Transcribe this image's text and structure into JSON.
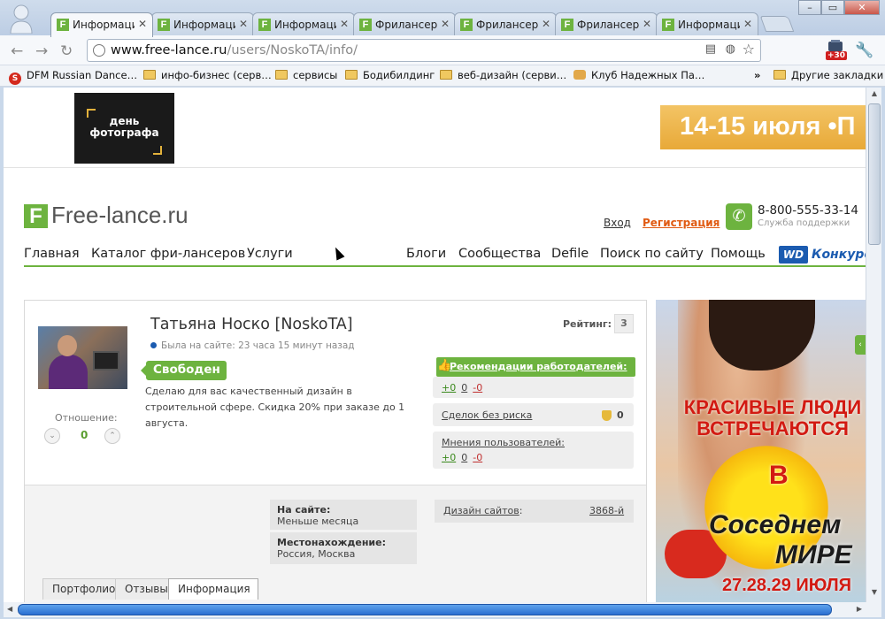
{
  "browser": {
    "tabs": [
      {
        "label": "Информаци",
        "close": "✕"
      },
      {
        "label": "Информаци",
        "close": "✕"
      },
      {
        "label": "Информаци",
        "close": "✕"
      },
      {
        "label": "Фрилансер",
        "close": "✕"
      },
      {
        "label": "Фрилансер",
        "close": "✕"
      },
      {
        "label": "Фрилансер",
        "close": "✕"
      },
      {
        "label": "Информаци",
        "close": "✕"
      }
    ],
    "favicon_letter": "F",
    "window_controls": {
      "minimize": "–",
      "maximize": "▭",
      "close": "✕"
    },
    "nav": {
      "back": "←",
      "forward": "→",
      "reload": "↻"
    },
    "url_host": "www.free-lance.ru",
    "url_path": "/users/NoskoTA/info/",
    "extension_badge": "+30",
    "bookmarks": [
      {
        "label": "DFM Russian Dance…",
        "icon": "s-logo-icon",
        "icon_text": "S"
      },
      {
        "label": "инфо-бизнес (серв…",
        "icon": "folder-icon"
      },
      {
        "label": "сервисы",
        "icon": "folder-icon"
      },
      {
        "label": "Бодибилдинг",
        "icon": "folder-icon"
      },
      {
        "label": "веб-дизайн (серви…",
        "icon": "folder-icon"
      },
      {
        "label": "Клуб Надежных Па…",
        "icon": "handshake-icon"
      }
    ],
    "bookmarks_more": "»",
    "other_bookmarks": "Другие закладки"
  },
  "banner": {
    "day_photo_line1": "день",
    "day_photo_line2": "фотографа",
    "july_text": "14-15 июля  •П"
  },
  "site": {
    "logo_letter": "F",
    "logo_text": "Free-lance.ru",
    "login": "Вход",
    "register": "Регистрация",
    "phone": "8-800-555-33-14",
    "support": "Служба поддержки",
    "menu_left": [
      "Главная",
      "Каталог фри-лансеров",
      "Услуги"
    ],
    "menu_right": [
      "Блоги",
      "Сообщества",
      "Defile",
      "Поиск по сайту",
      "Помощь"
    ],
    "wd_logo": "WD",
    "contest": "Конкурс"
  },
  "profile": {
    "name": "Татьяна Носко [NoskoTA]",
    "last_seen": "Была на сайте: 23 часа 15 минут назад",
    "status": "Свободен",
    "description": "Сделаю для вас качественный дизайн в строительной сфере. Скидка 20% при заказе до 1 августа.",
    "attitude_label": "Отношение:",
    "attitude_value": "0",
    "vote_down": "⌄",
    "vote_up": "⌃",
    "rating_label": "Рейтинг:",
    "rating_value": "3",
    "recommendations": {
      "title": "Рекомендации работодателей:",
      "plus": "+0",
      "neutral": "0",
      "minus": "-0"
    },
    "safe_deals": {
      "label": "Сделок без риска",
      "value": "0"
    },
    "opinions": {
      "title": "Мнения пользователей:",
      "plus": "+0",
      "neutral": "0",
      "minus": "-0"
    },
    "on_site_label": "На сайте:",
    "on_site_value": "Меньше месяца",
    "location_label": "Местонахождение:",
    "location_value": "Россия, Москва",
    "category_label": "Дизайн сайтов",
    "category_rank": "3868-й",
    "tabs": [
      "Портфолио",
      "Отзывы",
      "Информация"
    ],
    "active_tab": "Информация"
  },
  "ad": {
    "line1": "КРАСИВЫЕ ЛЮДИ ВСТРЕЧАЮТСЯ",
    "line2": "В",
    "line3": "Соседнем",
    "line4": "МИРЕ",
    "line5": "27.28.29 ИЮЛЯ"
  },
  "colors": {
    "brand_green": "#6db33f",
    "register_orange": "#e05a12",
    "scroll_blue": "#2b6fd1"
  }
}
